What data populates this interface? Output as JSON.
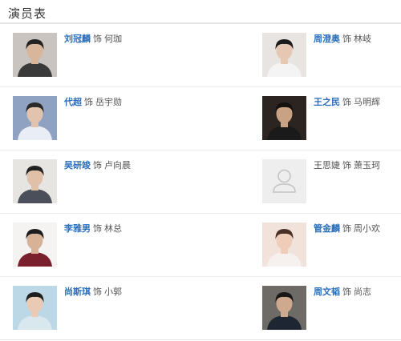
{
  "header": {
    "title": "演员表"
  },
  "cast": [
    {
      "actor": "刘冠麟",
      "as": "饰",
      "role": "何珈",
      "actor_linked": true,
      "photo": {
        "bg": "#c9c4bf",
        "skin": "#d9b59a",
        "hair": "#222222",
        "cloth": "#3a3a3a"
      }
    },
    {
      "actor": "周澄奥",
      "as": "饰",
      "role": "林岐",
      "actor_linked": true,
      "photo": {
        "bg": "#e8e4e2",
        "skin": "#e6c8b2",
        "hair": "#1c1c1c",
        "cloth": "#f4f4f4"
      }
    },
    {
      "actor": "代超",
      "as": "饰",
      "role": "岳宇勋",
      "actor_linked": true,
      "photo": {
        "bg": "#8fa2c2",
        "skin": "#e2c4ae",
        "hair": "#2a2a2a",
        "cloth": "#e9edf5"
      }
    },
    {
      "actor": "王之民",
      "as": "饰",
      "role": "马明辉",
      "actor_linked": true,
      "photo": {
        "bg": "#2b2420",
        "skin": "#c9a183",
        "hair": "#15110f",
        "cloth": "#1a1a1a"
      }
    },
    {
      "actor": "吴研竣",
      "as": "饰",
      "role": "卢向晨",
      "actor_linked": true,
      "photo": {
        "bg": "#e7e5e1",
        "skin": "#e0c0a6",
        "hair": "#222222",
        "cloth": "#4a4f5a"
      }
    },
    {
      "actor": "王思婕",
      "as": "饰",
      "role": "萧玉珂",
      "actor_linked": false,
      "photo": {
        "bg": "#eeeeee",
        "placeholder": true
      }
    },
    {
      "actor": "李雅男",
      "as": "饰",
      "role": "林总",
      "actor_linked": true,
      "photo": {
        "bg": "#f5f3f2",
        "skin": "#d7b296",
        "hair": "#1d1d1d",
        "cloth": "#7a1f2c"
      }
    },
    {
      "actor": "管金麟",
      "as": "饰",
      "role": "周小欢",
      "actor_linked": true,
      "photo": {
        "bg": "#f2e2dc",
        "skin": "#efcdb9",
        "hair": "#4a3027",
        "cloth": "#f6f0ee"
      }
    },
    {
      "actor": "尚斯琪",
      "as": "饰",
      "role": "小郭",
      "actor_linked": true,
      "photo": {
        "bg": "#bcd7e6",
        "skin": "#ebcab5",
        "hair": "#1e1e1e",
        "cloth": "#d9e7ee"
      }
    },
    {
      "actor": "周文韬",
      "as": "饰",
      "role": "尚志",
      "actor_linked": true,
      "photo": {
        "bg": "#6e6a66",
        "skin": "#cfa98d",
        "hair": "#181818",
        "cloth": "#1e2533"
      }
    }
  ]
}
